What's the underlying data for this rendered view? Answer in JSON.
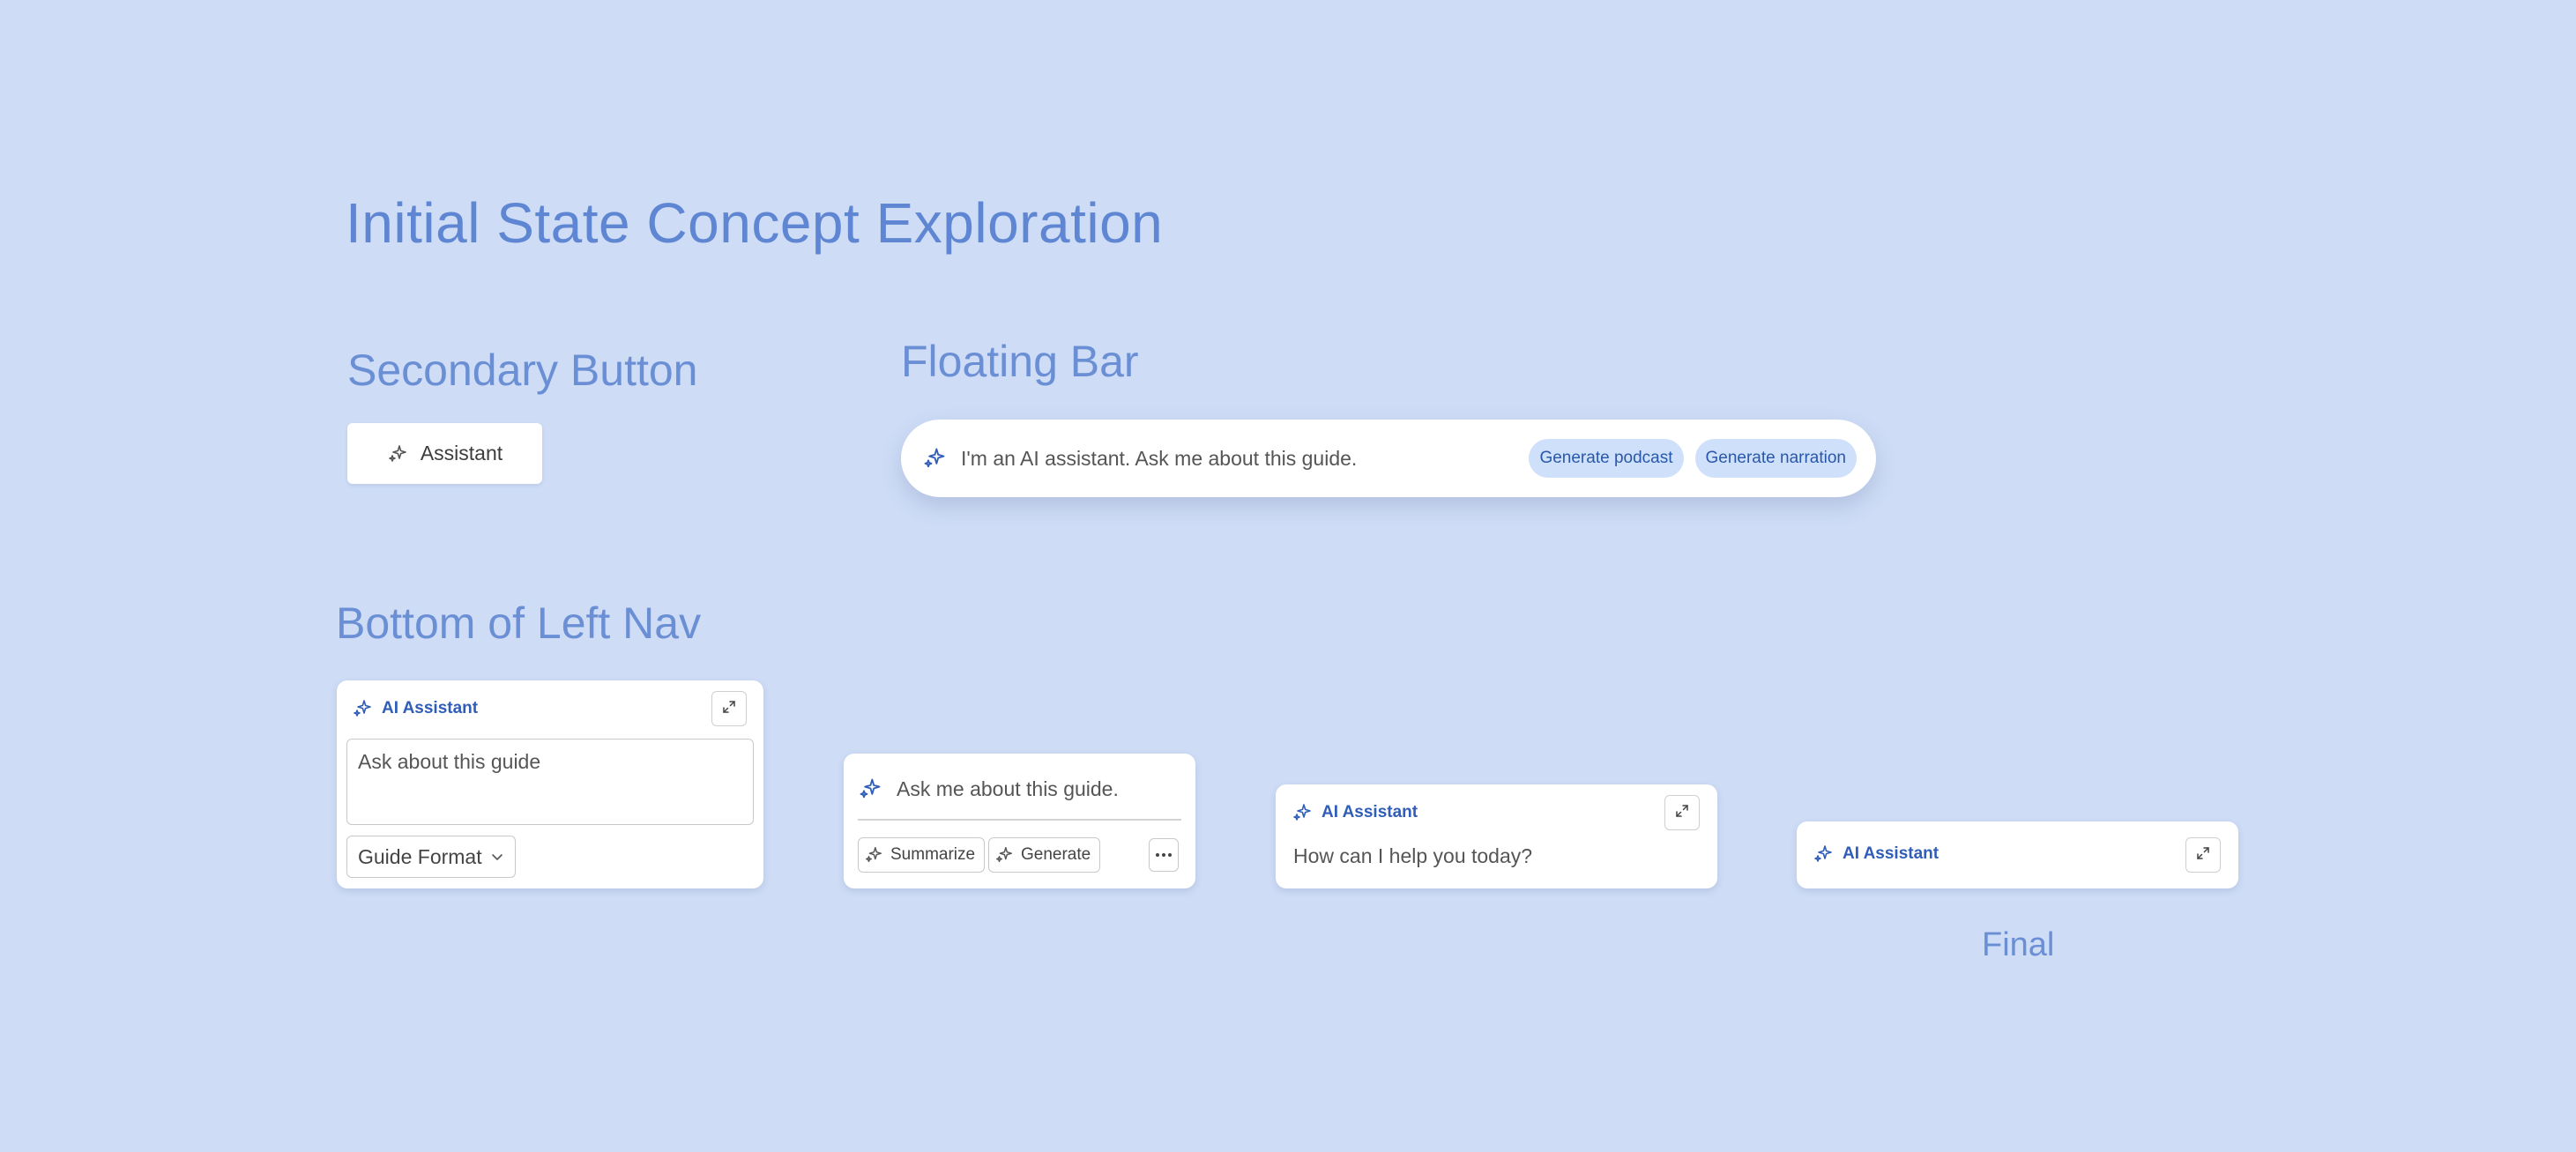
{
  "page": {
    "title": "Initial State Concept Exploration",
    "background_color": "#cedcf6"
  },
  "secondary_button_section": {
    "heading": "Secondary Button",
    "button_label": "Assistant"
  },
  "floating_bar_section": {
    "heading": "Floating Bar",
    "placeholder": "I'm an AI assistant. Ask me about this guide.",
    "chips": [
      "Generate podcast",
      "Generate narration"
    ]
  },
  "left_nav_section": {
    "heading": "Bottom of Left Nav",
    "card1": {
      "title": "AI Assistant",
      "input_placeholder": "Ask about this guide",
      "dropdown_value": "Guide Format",
      "icons": [
        "sparkle-icon",
        "expand-icon",
        "chevron-down-icon"
      ]
    },
    "card2": {
      "input_placeholder": "Ask me about this guide.",
      "summarize_label": "Summarize",
      "generate_label": "Generate",
      "icons": [
        "sparkle-icon",
        "more-icon"
      ]
    },
    "card3": {
      "title": "AI Assistant",
      "prompt": "How can I help you today?",
      "icons": [
        "sparkle-icon",
        "expand-icon"
      ]
    },
    "card4": {
      "title": "AI Assistant",
      "label": "Final",
      "icons": [
        "sparkle-icon",
        "expand-icon"
      ]
    }
  },
  "colors": {
    "heading": "#5f86d2",
    "accent_blue": "#2f5db8",
    "chip_bg": "#cfe0fb"
  }
}
